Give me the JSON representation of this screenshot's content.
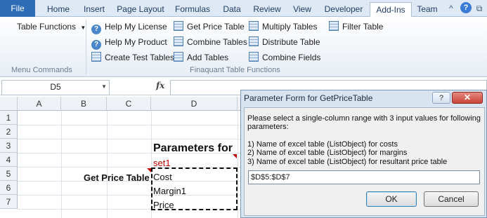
{
  "ribbon_tabs": [
    "File",
    "Home",
    "Insert",
    "Page Layout",
    "Formulas",
    "Data",
    "Review",
    "View",
    "Developer",
    "Add-Ins",
    "Team"
  ],
  "active_tab": "Add-Ins",
  "window_controls": {
    "minimize": "^",
    "help": "?",
    "restore": "⧉",
    "close": "✕"
  },
  "ribbon": {
    "table_functions": "Table Functions",
    "menu_commands_label": "Menu Commands",
    "group_label": "Finaquant Table Functions",
    "buttons": {
      "help_license": "Help My License",
      "help_product": "Help My Product",
      "create_test_tables": "Create Test Tables",
      "get_price_table": "Get Price Table",
      "combine_tables": "Combine Tables",
      "add_tables": "Add Tables",
      "multiply_tables": "Multiply Tables",
      "distribute_table": "Distribute Table",
      "combine_fields": "Combine Fields",
      "filter_table": "Filter Table"
    }
  },
  "formula_bar": {
    "name_box": "D5",
    "fx": "fx"
  },
  "grid": {
    "columns": [
      "A",
      "B",
      "C",
      "D"
    ],
    "rows": [
      "1",
      "2",
      "3",
      "4",
      "5",
      "6",
      "7"
    ],
    "cells": {
      "D3": "Parameters for",
      "D4": "set1",
      "B5": "Get Price Table",
      "D5": "Cost",
      "D6": "Margin1",
      "D7": "Price"
    }
  },
  "dialog": {
    "title": "Parameter Form for GetPriceTable",
    "help": "?",
    "close": "✕",
    "intro_line1": "Please select a single-column range with 3 input values for following",
    "intro_line2": "parameters:",
    "param1": "1) Name of excel table (ListObject) for costs",
    "param2": "2) Name of excel table (ListObject) for margins",
    "param3": "3) Name of excel table (ListObject) for resultant price table",
    "range_value": "$D$5:$D$7",
    "ok": "OK",
    "cancel": "Cancel"
  },
  "colors": {
    "file_tab": "#2d6db5",
    "accent": "#3a7bd5",
    "selection_red": "#c00000"
  }
}
